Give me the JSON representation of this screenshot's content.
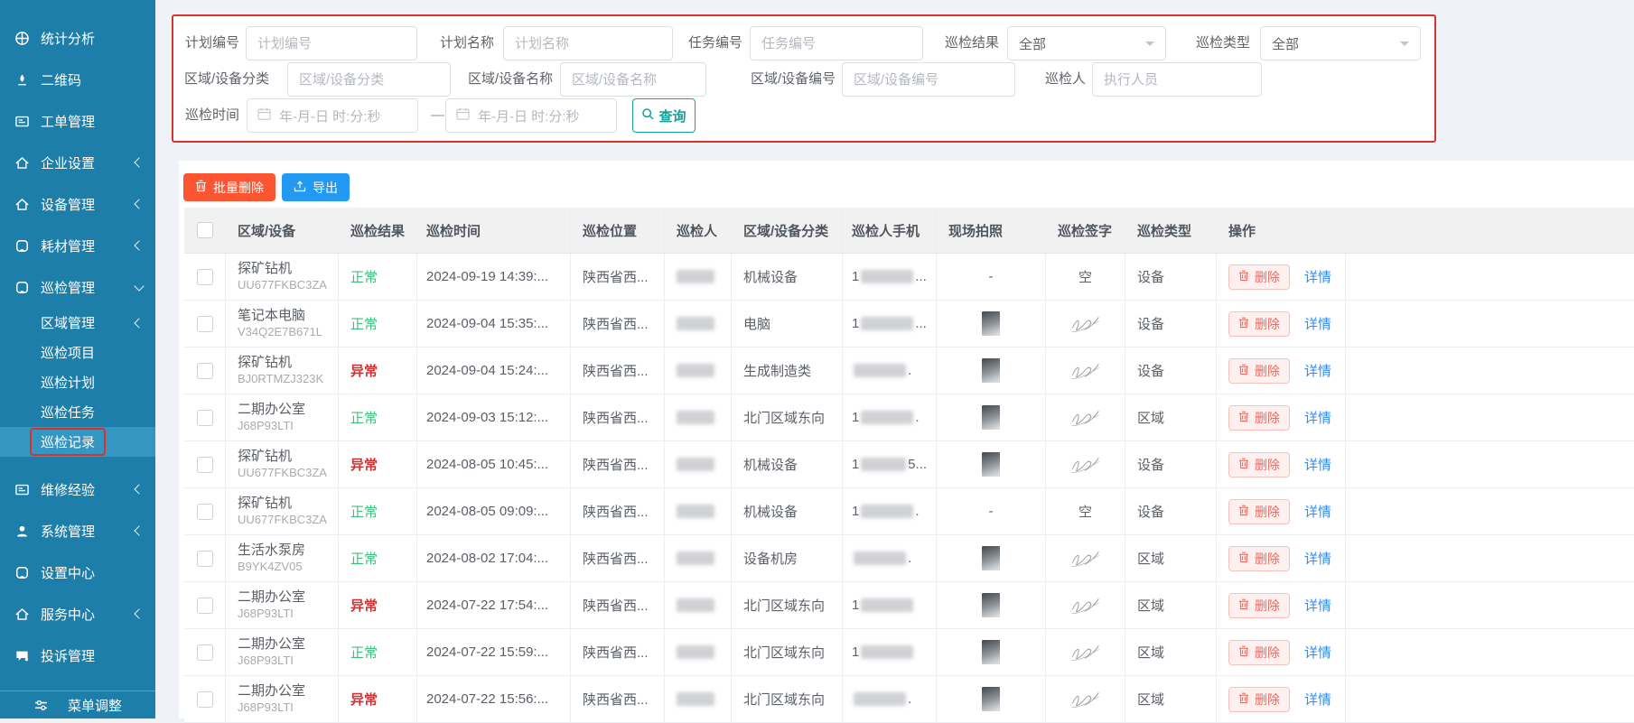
{
  "sidebar": {
    "items": [
      {
        "key": "statistics",
        "icon": "statistics-icon",
        "label": "统计分析",
        "expandable": false
      },
      {
        "key": "qrcode",
        "icon": "qrcode-icon",
        "label": "二维码",
        "expandable": false
      },
      {
        "key": "work-orders",
        "icon": "work-order-icon",
        "label": "工单管理",
        "expandable": false
      },
      {
        "key": "enterprise-settings",
        "icon": "enterprise-icon",
        "label": "企业设置",
        "expandable": true
      },
      {
        "key": "device-management",
        "icon": "device-icon",
        "label": "设备管理",
        "expandable": true
      },
      {
        "key": "consumables",
        "icon": "consumables-icon",
        "label": "耗材管理",
        "expandable": true
      },
      {
        "key": "inspection",
        "icon": "inspection-icon",
        "label": "巡检管理",
        "expandable": true,
        "expanded": true,
        "children": [
          {
            "key": "area-management",
            "label": "区域管理",
            "expandable": true
          },
          {
            "key": "inspection-items",
            "label": "巡检项目"
          },
          {
            "key": "inspection-plans",
            "label": "巡检计划"
          },
          {
            "key": "inspection-tasks",
            "label": "巡检任务"
          },
          {
            "key": "inspection-records",
            "label": "巡检记录",
            "active": true
          }
        ]
      },
      {
        "key": "repair-experience",
        "icon": "repair-icon",
        "label": "维修经验",
        "expandable": true
      },
      {
        "key": "system-management",
        "icon": "user-icon",
        "label": "系统管理",
        "expandable": true
      },
      {
        "key": "settings-center",
        "icon": "settings-icon",
        "label": "设置中心",
        "expandable": false
      },
      {
        "key": "service-center",
        "icon": "service-icon",
        "label": "服务中心",
        "expandable": true
      },
      {
        "key": "complaints",
        "icon": "complaint-icon",
        "label": "投诉管理",
        "expandable": false
      }
    ],
    "footer": {
      "label": "菜单调整",
      "icon": "menu-adjust-icon"
    }
  },
  "filters": {
    "plan_no": {
      "label": "计划编号",
      "placeholder": "计划编号"
    },
    "plan_name": {
      "label": "计划名称",
      "placeholder": "计划名称"
    },
    "task_no": {
      "label": "任务编号",
      "placeholder": "任务编号"
    },
    "result": {
      "label": "巡检结果",
      "value": "全部"
    },
    "type": {
      "label": "巡检类型",
      "value": "全部"
    },
    "area_category": {
      "label": "区域/设备分类",
      "placeholder": "区域/设备分类"
    },
    "area_name": {
      "label": "区域/设备名称",
      "placeholder": "区域/设备名称"
    },
    "area_no": {
      "label": "区域/设备编号",
      "placeholder": "区域/设备编号"
    },
    "inspector": {
      "label": "巡检人",
      "placeholder": "执行人员"
    },
    "time": {
      "label": "巡检时间",
      "placeholder_start": "年-月-日 时:分:秒",
      "placeholder_end": "年-月-日 时:分:秒",
      "separator": "—"
    },
    "search_label": "查询"
  },
  "toolbar": {
    "batch_delete": "批量删除",
    "export": "导出"
  },
  "table": {
    "headers": [
      "区域/设备",
      "巡检结果",
      "巡检时间",
      "巡检位置",
      "巡检人",
      "区域/设备分类",
      "巡检人手机",
      "现场拍照",
      "巡检签字",
      "巡检类型",
      "操作"
    ],
    "actions": {
      "delete": "删除",
      "detail": "详情"
    },
    "rows": [
      {
        "name": "探矿钻机",
        "code": "UU677FKBC3ZA",
        "result": "正常",
        "time": "2024-09-19 14:39:...",
        "location": "陕西省西...",
        "inspector_masked": true,
        "category": "机械设备",
        "phone_prefix": "1",
        "phone_suffix": "...",
        "photo": "-",
        "signature": "空",
        "type": "设备"
      },
      {
        "name": "笔记本电脑",
        "code": "V34Q2E7B671L",
        "result": "正常",
        "time": "2024-09-04 15:35:...",
        "location": "陕西省西...",
        "inspector_masked": true,
        "category": "电脑",
        "phone_prefix": "1",
        "phone_suffix": "...",
        "photo": "photo",
        "signature": "sign",
        "type": "设备"
      },
      {
        "name": "探矿钻机",
        "code": "BJ0RTMZJ323K",
        "result": "异常",
        "time": "2024-09-04 15:24:...",
        "location": "陕西省西...",
        "inspector_masked": true,
        "category": "生成制造类",
        "phone_prefix": "",
        "phone_suffix": ".",
        "photo": "photo",
        "signature": "sign",
        "type": "设备"
      },
      {
        "name": "二期办公室",
        "code": "J68P93LTI",
        "result": "正常",
        "time": "2024-09-03 15:12:...",
        "location": "陕西省西...",
        "inspector_masked": true,
        "category": "北门区域东向",
        "phone_prefix": "1",
        "phone_suffix": ".",
        "photo": "photo",
        "signature": "sign",
        "type": "区域"
      },
      {
        "name": "探矿钻机",
        "code": "UU677FKBC3ZA",
        "result": "异常",
        "time": "2024-08-05 10:45:...",
        "location": "陕西省西...",
        "inspector_masked": true,
        "category": "机械设备",
        "phone_prefix": "1",
        "phone_suffix": "5...",
        "photo": "photo",
        "signature": "sign",
        "type": "设备"
      },
      {
        "name": "探矿钻机",
        "code": "UU677FKBC3ZA",
        "result": "正常",
        "time": "2024-08-05 09:09:...",
        "location": "陕西省西...",
        "inspector_masked": true,
        "category": "机械设备",
        "phone_prefix": "1",
        "phone_suffix": ".",
        "photo": "-",
        "signature": "空",
        "type": "设备"
      },
      {
        "name": "生活水泵房",
        "code": "B9YK4ZV05",
        "result": "正常",
        "time": "2024-08-02 17:04:...",
        "location": "陕西省西...",
        "inspector_masked": true,
        "category": "设备机房",
        "phone_prefix": "",
        "phone_suffix": ".",
        "photo": "photo",
        "signature": "sign",
        "type": "区域"
      },
      {
        "name": "二期办公室",
        "code": "J68P93LTI",
        "result": "异常",
        "time": "2024-07-22 17:54:...",
        "location": "陕西省西...",
        "inspector_masked": true,
        "category": "北门区域东向",
        "phone_prefix": "1",
        "phone_suffix": "",
        "photo": "photo",
        "signature": "sign",
        "type": "区域"
      },
      {
        "name": "二期办公室",
        "code": "J68P93LTI",
        "result": "正常",
        "time": "2024-07-22 15:59:...",
        "location": "陕西省西...",
        "inspector_masked": true,
        "category": "北门区域东向",
        "phone_prefix": "1",
        "phone_suffix": "",
        "photo": "photo",
        "signature": "sign",
        "type": "区域"
      },
      {
        "name": "二期办公室",
        "code": "J68P93LTI",
        "result": "异常",
        "time": "2024-07-22 15:56:...",
        "location": "陕西省西...",
        "inspector_masked": true,
        "category": "北门区域东向",
        "phone_prefix": "",
        "phone_suffix": ".",
        "photo": "photo",
        "signature": "sign",
        "type": "区域"
      }
    ]
  },
  "colors": {
    "sidebar": "#1d7fa9",
    "sidebar_active": "#3496c1",
    "annotation_red": "#d8342c",
    "normal_green": "#3ebe7c",
    "abnormal_red": "#ce3333",
    "batch_delete_btn": "#fc5531",
    "export_btn": "#2499f2",
    "search_btn": "#18a197",
    "detail_link": "#2e8df2",
    "page_bg": "#eff2f7"
  }
}
